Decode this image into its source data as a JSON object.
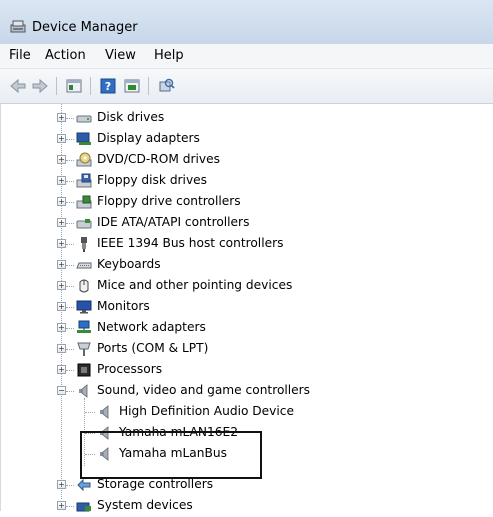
{
  "window": {
    "title": "Device Manager"
  },
  "menu": [
    "File",
    "Action",
    "View",
    "Help"
  ],
  "toolbar": {
    "buttons": [
      "back-arrow",
      "forward-arrow",
      "properties",
      "help",
      "scan-hardware",
      "update-driver"
    ]
  },
  "tree": {
    "categories": [
      {
        "label": "Disk drives",
        "icon": "disk-drive-icon"
      },
      {
        "label": "Display adapters",
        "icon": "display-adapter-icon"
      },
      {
        "label": "DVD/CD-ROM drives",
        "icon": "dvd-drive-icon"
      },
      {
        "label": "Floppy disk drives",
        "icon": "floppy-disk-icon"
      },
      {
        "label": "Floppy drive controllers",
        "icon": "floppy-controller-icon"
      },
      {
        "label": "IDE ATA/ATAPI controllers",
        "icon": "ide-controller-icon"
      },
      {
        "label": "IEEE 1394 Bus host controllers",
        "icon": "ieee1394-icon"
      },
      {
        "label": "Keyboards",
        "icon": "keyboard-icon"
      },
      {
        "label": "Mice and other pointing devices",
        "icon": "mouse-icon"
      },
      {
        "label": "Monitors",
        "icon": "monitor-icon"
      },
      {
        "label": "Network adapters",
        "icon": "network-adapter-icon"
      },
      {
        "label": "Ports (COM & LPT)",
        "icon": "port-icon"
      },
      {
        "label": "Processors",
        "icon": "processor-icon"
      },
      {
        "label": "Sound, video and game controllers",
        "icon": "speaker-icon"
      }
    ],
    "sound_children": [
      "High Definition Audio Device",
      "Yamaha mLAN16E2",
      "Yamaha mLanBus"
    ],
    "after": [
      {
        "label": "Storage controllers",
        "icon": "storage-icon"
      },
      {
        "label": "System devices",
        "icon": "system-device-icon"
      }
    ]
  }
}
